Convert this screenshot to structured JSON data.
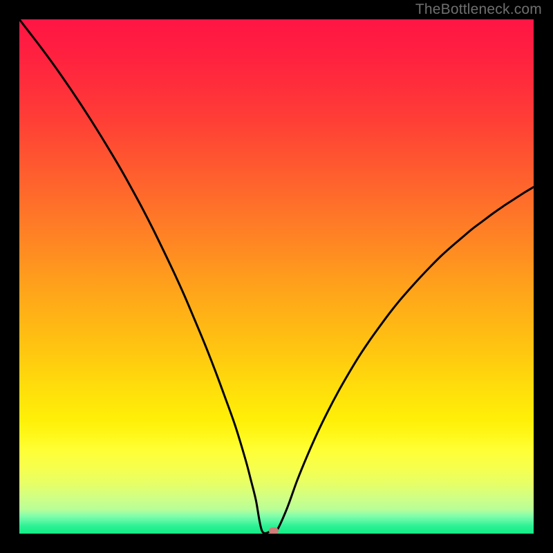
{
  "watermark": "TheBottleneck.com",
  "chart_data": {
    "type": "line",
    "title": "",
    "xlabel": "",
    "ylabel": "",
    "xlim": [
      0,
      100
    ],
    "ylim": [
      0,
      100
    ],
    "grid": false,
    "legend": false,
    "background_gradient_stops": [
      {
        "offset": 0.0,
        "color": "#ff1544"
      },
      {
        "offset": 0.065,
        "color": "#ff2040"
      },
      {
        "offset": 0.13,
        "color": "#ff2e3b"
      },
      {
        "offset": 0.195,
        "color": "#ff3e36"
      },
      {
        "offset": 0.26,
        "color": "#ff5231"
      },
      {
        "offset": 0.325,
        "color": "#ff652c"
      },
      {
        "offset": 0.39,
        "color": "#ff7927"
      },
      {
        "offset": 0.455,
        "color": "#ff8d21"
      },
      {
        "offset": 0.52,
        "color": "#ffa21b"
      },
      {
        "offset": 0.585,
        "color": "#ffb515"
      },
      {
        "offset": 0.65,
        "color": "#ffc810"
      },
      {
        "offset": 0.715,
        "color": "#ffdd0b"
      },
      {
        "offset": 0.78,
        "color": "#fff008"
      },
      {
        "offset": 0.81,
        "color": "#fff81b"
      },
      {
        "offset": 0.838,
        "color": "#ffff36"
      },
      {
        "offset": 0.87,
        "color": "#f7ff4b"
      },
      {
        "offset": 0.9,
        "color": "#e8ff64"
      },
      {
        "offset": 0.93,
        "color": "#cfff85"
      },
      {
        "offset": 0.953,
        "color": "#b8fe98"
      },
      {
        "offset": 0.965,
        "color": "#84feab"
      },
      {
        "offset": 0.975,
        "color": "#5bf8a3"
      },
      {
        "offset": 0.985,
        "color": "#2ef195"
      },
      {
        "offset": 1.0,
        "color": "#11ed86"
      }
    ],
    "series": [
      {
        "name": "curve",
        "type": "line",
        "color": "#000000",
        "stroke_width": 3,
        "x": [
          0.0,
          2.0,
          4.0,
          6.0,
          8.0,
          10.0,
          12.0,
          14.0,
          16.0,
          18.0,
          20.0,
          22.0,
          24.0,
          26.0,
          28.0,
          30.0,
          32.0,
          34.0,
          36.0,
          38.0,
          40.0,
          42.0,
          44.0,
          45.0,
          46.0,
          47.2,
          49.0,
          50.0,
          52.0,
          54.0,
          56.0,
          58.0,
          60.0,
          62.0,
          64.0,
          66.0,
          68.0,
          70.0,
          72.0,
          74.0,
          76.0,
          78.0,
          80.0,
          82.0,
          84.0,
          86.0,
          88.0,
          90.0,
          92.0,
          94.0,
          96.0,
          98.0,
          100.0
        ],
        "y": [
          100.0,
          97.4,
          94.8,
          92.1,
          89.3,
          86.4,
          83.4,
          80.3,
          77.1,
          73.8,
          70.4,
          66.8,
          63.1,
          59.2,
          55.1,
          50.9,
          46.5,
          41.8,
          37.0,
          31.9,
          26.5,
          20.9,
          14.3,
          10.5,
          6.5,
          0.5,
          0.5,
          0.5,
          4.8,
          10.3,
          15.2,
          19.7,
          23.8,
          27.6,
          31.1,
          34.4,
          37.4,
          40.2,
          42.9,
          45.4,
          47.7,
          49.9,
          52.0,
          54.0,
          55.8,
          57.5,
          59.2,
          60.7,
          62.2,
          63.6,
          64.9,
          66.2,
          67.4
        ]
      }
    ],
    "marker": {
      "name": "minimum-marker",
      "x": 49.5,
      "y": 0.5,
      "color": "#cf7d78"
    }
  }
}
